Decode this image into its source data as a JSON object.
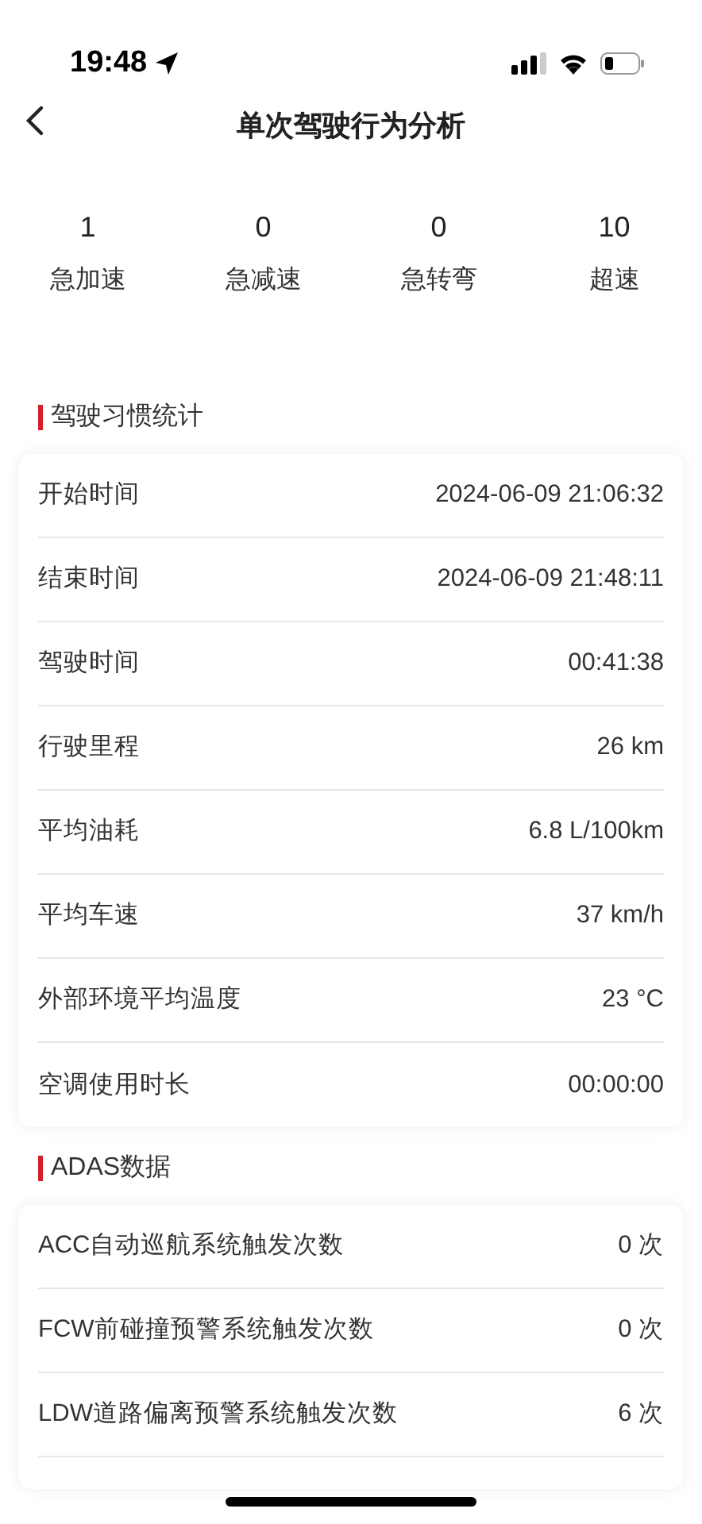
{
  "status_bar": {
    "time": "19:48"
  },
  "nav": {
    "title": "单次驾驶行为分析"
  },
  "stats": [
    {
      "value": "1",
      "label": "急加速"
    },
    {
      "value": "0",
      "label": "急减速"
    },
    {
      "value": "0",
      "label": "急转弯"
    },
    {
      "value": "10",
      "label": "超速"
    }
  ],
  "sections": [
    {
      "title": "驾驶习惯统计",
      "rows": [
        {
          "label": "开始时间",
          "value": "2024-06-09 21:06:32"
        },
        {
          "label": "结束时间",
          "value": "2024-06-09 21:48:11"
        },
        {
          "label": "驾驶时间",
          "value": "00:41:38"
        },
        {
          "label": "行驶里程",
          "value": "26 km"
        },
        {
          "label": "平均油耗",
          "value": "6.8 L/100km"
        },
        {
          "label": "平均车速",
          "value": "37 km/h"
        },
        {
          "label": "外部环境平均温度",
          "value": "23 °C"
        },
        {
          "label": "空调使用时长",
          "value": "00:00:00"
        }
      ]
    },
    {
      "title": "ADAS数据",
      "rows": [
        {
          "label": "ACC自动巡航系统触发次数",
          "value": "0 次"
        },
        {
          "label": "FCW前碰撞预警系统触发次数",
          "value": "0 次"
        },
        {
          "label": "LDW道路偏离预警系统触发次数",
          "value": "6 次"
        }
      ]
    }
  ]
}
